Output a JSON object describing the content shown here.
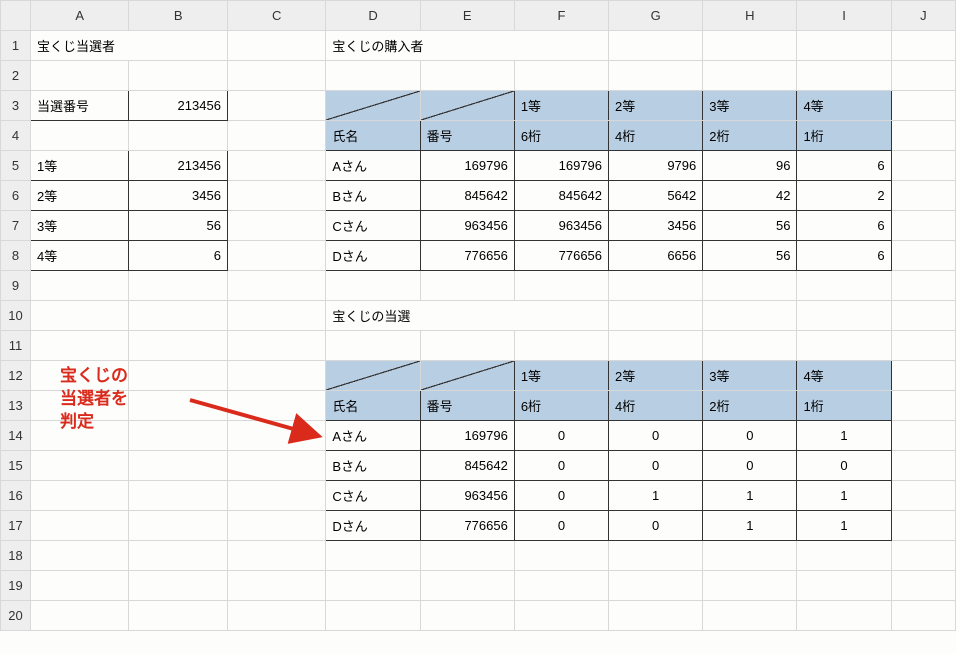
{
  "columns": [
    "A",
    "B",
    "C",
    "D",
    "E",
    "F",
    "G",
    "H",
    "I",
    "J"
  ],
  "rows": [
    "1",
    "2",
    "3",
    "4",
    "5",
    "6",
    "7",
    "8",
    "9",
    "10",
    "11",
    "12",
    "13",
    "14",
    "15",
    "16",
    "17",
    "18",
    "19",
    "20"
  ],
  "titles": {
    "winners": "宝くじ当選者",
    "buyers": "宝くじの購入者",
    "results": "宝くじの当選"
  },
  "winning": {
    "numberLabel": "当選番号",
    "number": "213456",
    "prizes": [
      {
        "rank": "1等",
        "value": "213456"
      },
      {
        "rank": "2等",
        "value": "3456"
      },
      {
        "rank": "3等",
        "value": "56"
      },
      {
        "rank": "4等",
        "value": "6"
      }
    ]
  },
  "buyerTable": {
    "header1": [
      "1等",
      "2等",
      "3等",
      "4等"
    ],
    "header2": [
      "氏名",
      "番号",
      "6桁",
      "4桁",
      "2桁",
      "1桁"
    ],
    "rows": [
      {
        "name": "Aさん",
        "num": "169796",
        "d6": "169796",
        "d4": "9796",
        "d2": "96",
        "d1": "6"
      },
      {
        "name": "Bさん",
        "num": "845642",
        "d6": "845642",
        "d4": "5642",
        "d2": "42",
        "d1": "2"
      },
      {
        "name": "Cさん",
        "num": "963456",
        "d6": "963456",
        "d4": "3456",
        "d2": "56",
        "d1": "6"
      },
      {
        "name": "Dさん",
        "num": "776656",
        "d6": "776656",
        "d4": "6656",
        "d2": "56",
        "d1": "6"
      }
    ]
  },
  "resultTable": {
    "header1": [
      "1等",
      "2等",
      "3等",
      "4等"
    ],
    "header2": [
      "氏名",
      "番号",
      "6桁",
      "4桁",
      "2桁",
      "1桁"
    ],
    "rows": [
      {
        "name": "Aさん",
        "num": "169796",
        "d6": "0",
        "d4": "0",
        "d2": "0",
        "d1": "1"
      },
      {
        "name": "Bさん",
        "num": "845642",
        "d6": "0",
        "d4": "0",
        "d2": "0",
        "d1": "0"
      },
      {
        "name": "Cさん",
        "num": "963456",
        "d6": "0",
        "d4": "1",
        "d2": "1",
        "d1": "1"
      },
      {
        "name": "Dさん",
        "num": "776656",
        "d6": "0",
        "d4": "0",
        "d2": "1",
        "d1": "1"
      }
    ]
  },
  "annotation": "宝くじの\n当選者を\n判定",
  "chart_data": {
    "type": "table",
    "tables": [
      {
        "title": "宝くじ当選者",
        "data": [
          [
            "当選番号",
            213456
          ],
          [
            "1等",
            213456
          ],
          [
            "2等",
            3456
          ],
          [
            "3等",
            56
          ],
          [
            "4等",
            6
          ]
        ]
      },
      {
        "title": "宝くじの購入者",
        "columns": [
          "氏名",
          "番号",
          "6桁(1等)",
          "4桁(2等)",
          "2桁(3等)",
          "1桁(4等)"
        ],
        "rows": [
          [
            "Aさん",
            169796,
            169796,
            9796,
            96,
            6
          ],
          [
            "Bさん",
            845642,
            845642,
            5642,
            42,
            2
          ],
          [
            "Cさん",
            963456,
            963456,
            3456,
            56,
            6
          ],
          [
            "Dさん",
            776656,
            776656,
            6656,
            56,
            6
          ]
        ]
      },
      {
        "title": "宝くじの当選",
        "columns": [
          "氏名",
          "番号",
          "6桁(1等)",
          "4桁(2等)",
          "2桁(3等)",
          "1桁(4等)"
        ],
        "rows": [
          [
            "Aさん",
            169796,
            0,
            0,
            0,
            1
          ],
          [
            "Bさん",
            845642,
            0,
            0,
            0,
            0
          ],
          [
            "Cさん",
            963456,
            0,
            1,
            1,
            1
          ],
          [
            "Dさん",
            776656,
            0,
            0,
            1,
            1
          ]
        ]
      }
    ]
  }
}
